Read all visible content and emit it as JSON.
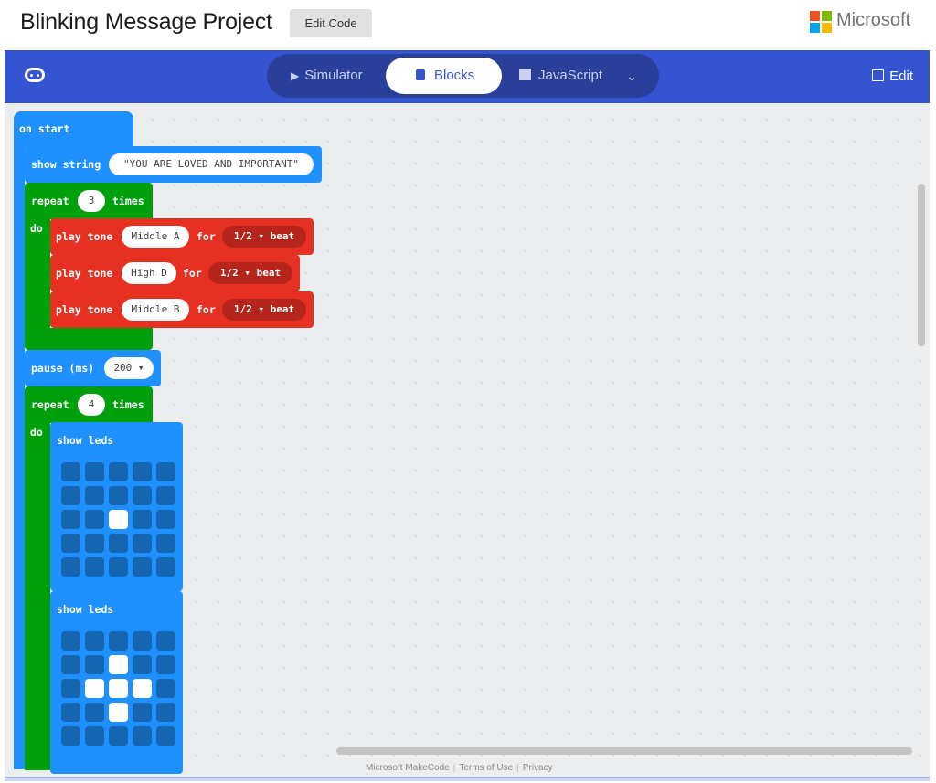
{
  "header": {
    "project_title": "Blinking Message Project",
    "edit_code_label": "Edit Code",
    "brand_text": "Microsoft",
    "brand_colors": [
      "#f25022",
      "#7fba00",
      "#00a4ef",
      "#ffb900"
    ]
  },
  "menubar": {
    "tabs": [
      {
        "label": "Simulator",
        "icon": "play-icon",
        "active": false
      },
      {
        "label": "Blocks",
        "icon": "puzzle-icon",
        "active": true
      },
      {
        "label": "JavaScript",
        "icon": "js-icon",
        "active": false
      }
    ],
    "more_icon": "chevron-down-icon",
    "edit_label": "Edit",
    "device_icon": "microbit-icon",
    "accent": "#3454d1"
  },
  "blocks": {
    "on_start": "on start",
    "show_string": {
      "label": "show string",
      "value": "\"YOU ARE LOVED AND IMPORTANT\""
    },
    "repeat1": {
      "label": "repeat",
      "count": "3",
      "times": "times",
      "do": "do"
    },
    "tones": [
      {
        "label": "play tone",
        "note": "Middle A",
        "for": "for",
        "beat": "1/2 ▾",
        "unit": "beat"
      },
      {
        "label": "play tone",
        "note": "High D",
        "for": "for",
        "beat": "1/2 ▾",
        "unit": "beat"
      },
      {
        "label": "play tone",
        "note": "Middle B",
        "for": "for",
        "beat": "1/2 ▾",
        "unit": "beat"
      }
    ],
    "pause": {
      "label": "pause (ms)",
      "value": "200 ▾"
    },
    "repeat2": {
      "label": "repeat",
      "count": "4",
      "times": "times",
      "do": "do"
    },
    "show_leds_1": {
      "label": "show leds",
      "leds": [
        [
          0,
          0,
          0,
          0,
          0
        ],
        [
          0,
          0,
          0,
          0,
          0
        ],
        [
          0,
          0,
          1,
          0,
          0
        ],
        [
          0,
          0,
          0,
          0,
          0
        ],
        [
          0,
          0,
          0,
          0,
          0
        ]
      ]
    },
    "show_leds_2": {
      "label": "show leds",
      "leds": [
        [
          0,
          0,
          0,
          0,
          0
        ],
        [
          0,
          0,
          1,
          0,
          0
        ],
        [
          0,
          1,
          1,
          1,
          0
        ],
        [
          0,
          0,
          1,
          0,
          0
        ],
        [
          0,
          0,
          0,
          0,
          0
        ]
      ]
    }
  },
  "footer": {
    "items": [
      "Microsoft MakeCode",
      "Terms of Use",
      "Privacy"
    ]
  }
}
